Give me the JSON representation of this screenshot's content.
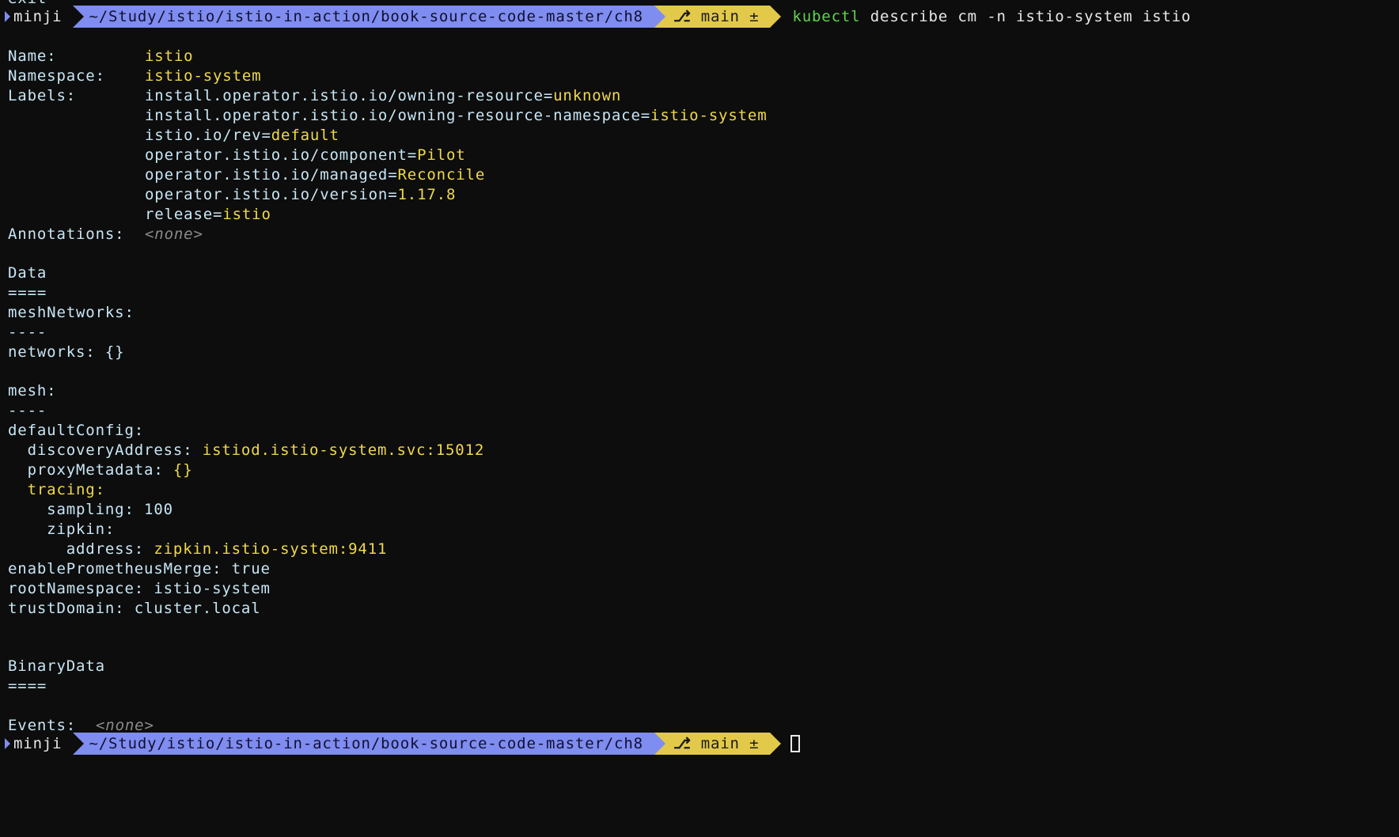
{
  "top_cut": "exit",
  "prompt": {
    "user": "minji",
    "path": "~/Study/istio/istio-in-action/book-source-code-master/ch8",
    "branch": "main ±",
    "branch_icon": "git-branch-icon",
    "command": "kubectl",
    "args": "describe cm -n istio-system istio"
  },
  "output": {
    "name_label": "Name:",
    "name_value": "istio",
    "namespace_label": "Namespace:",
    "namespace_value": "istio-system",
    "labels_label": "Labels:",
    "labels": [
      {
        "key": "install.operator.istio.io/owning-resource=",
        "value": "unknown"
      },
      {
        "key": "install.operator.istio.io/owning-resource-namespace=",
        "value": "istio-system"
      },
      {
        "key": "istio.io/rev=",
        "value": "default"
      },
      {
        "key": "operator.istio.io/component=",
        "value": "Pilot"
      },
      {
        "key": "operator.istio.io/managed=",
        "value": "Reconcile"
      },
      {
        "key": "operator.istio.io/version=",
        "value": "1.17.8"
      },
      {
        "key": "release=",
        "value": "istio"
      }
    ],
    "annotations_label": "Annotations:",
    "annotations_value": "<none>",
    "data_header": "Data",
    "data_rule": "====",
    "meshNetworks_key": "meshNetworks:",
    "meshNetworks_rule": "----",
    "networks_line": "networks: {}",
    "mesh_key": "mesh:",
    "mesh_rule": "----",
    "defaultConfig_key": "defaultConfig:",
    "discovery_key": "  discoveryAddress: ",
    "discovery_value": "istiod.istio-system.svc:15012",
    "proxyMetadata_key": "  proxyMetadata: ",
    "proxyMetadata_value": "{}",
    "tracing_key": "  tracing:",
    "sampling_line": "    sampling: 100",
    "zipkin_key": "    zipkin:",
    "address_key": "      address: ",
    "address_value": "zipkin.istio-system:9411",
    "enablePrometheusMerge_line": "enablePrometheusMerge: true",
    "rootNamespace_line": "rootNamespace: istio-system",
    "trustDomain_line": "trustDomain: cluster.local",
    "binaryData_header": "BinaryData",
    "binaryData_rule": "====",
    "events_label": "Events:",
    "events_value": "<none>"
  },
  "colors": {
    "prompt_path_bg": "#7f8cf0",
    "prompt_git_bg": "#e2c94a",
    "value_yellow": "#f0d94a",
    "command_green": "#5fd34b",
    "text_cyan": "#c8e6f5"
  }
}
